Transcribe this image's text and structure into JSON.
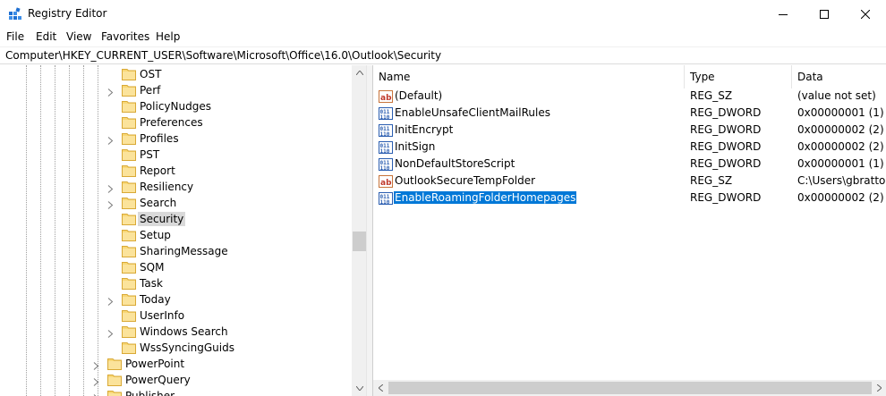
{
  "window": {
    "title": "Registry Editor"
  },
  "menu": {
    "items": [
      "File",
      "Edit",
      "View",
      "Favorites",
      "Help"
    ]
  },
  "address": {
    "path": "Computer\\HKEY_CURRENT_USER\\Software\\Microsoft\\Office\\16.0\\Outlook\\Security"
  },
  "tree": {
    "items": [
      {
        "label": "OST",
        "expandable": false,
        "selected": false
      },
      {
        "label": "Perf",
        "expandable": true,
        "selected": false
      },
      {
        "label": "PolicyNudges",
        "expandable": false,
        "selected": false
      },
      {
        "label": "Preferences",
        "expandable": false,
        "selected": false
      },
      {
        "label": "Profiles",
        "expandable": true,
        "selected": false
      },
      {
        "label": "PST",
        "expandable": false,
        "selected": false
      },
      {
        "label": "Report",
        "expandable": false,
        "selected": false
      },
      {
        "label": "Resiliency",
        "expandable": true,
        "selected": false
      },
      {
        "label": "Search",
        "expandable": true,
        "selected": false
      },
      {
        "label": "Security",
        "expandable": false,
        "selected": true
      },
      {
        "label": "Setup",
        "expandable": false,
        "selected": false
      },
      {
        "label": "SharingMessage",
        "expandable": false,
        "selected": false
      },
      {
        "label": "SQM",
        "expandable": false,
        "selected": false
      },
      {
        "label": "Task",
        "expandable": false,
        "selected": false
      },
      {
        "label": "Today",
        "expandable": true,
        "selected": false
      },
      {
        "label": "UserInfo",
        "expandable": false,
        "selected": false
      },
      {
        "label": "Windows Search",
        "expandable": true,
        "selected": false
      },
      {
        "label": "WssSyncingGuids",
        "expandable": false,
        "selected": false
      }
    ],
    "parent_items": [
      {
        "label": "PowerPoint",
        "expandable": true
      },
      {
        "label": "PowerQuery",
        "expandable": true
      },
      {
        "label": "Publisher",
        "expandable": true
      }
    ]
  },
  "list": {
    "columns": {
      "name": "Name",
      "type": "Type",
      "data": "Data"
    },
    "rows": [
      {
        "icon": "string-value-icon",
        "name": "(Default)",
        "type": "REG_SZ",
        "data": "(value not set)",
        "selected": false
      },
      {
        "icon": "binary-value-icon",
        "name": "EnableUnsafeClientMailRules",
        "type": "REG_DWORD",
        "data": "0x00000001 (1)",
        "selected": false
      },
      {
        "icon": "binary-value-icon",
        "name": "InitEncrypt",
        "type": "REG_DWORD",
        "data": "0x00000002 (2)",
        "selected": false
      },
      {
        "icon": "binary-value-icon",
        "name": "InitSign",
        "type": "REG_DWORD",
        "data": "0x00000002 (2)",
        "selected": false
      },
      {
        "icon": "binary-value-icon",
        "name": "NonDefaultStoreScript",
        "type": "REG_DWORD",
        "data": "0x00000001 (1)",
        "selected": false
      },
      {
        "icon": "string-value-icon",
        "name": "OutlookSecureTempFolder",
        "type": "REG_SZ",
        "data": "C:\\Users\\gbratton.",
        "selected": false
      },
      {
        "icon": "binary-value-icon",
        "name": "EnableRoamingFolderHomepages",
        "type": "REG_DWORD",
        "data": "0x00000002 (2)",
        "selected": true
      }
    ]
  },
  "colors": {
    "selection": "#0078d7",
    "tree_selection": "#d9d9d9",
    "folder": "#f5c34b"
  }
}
